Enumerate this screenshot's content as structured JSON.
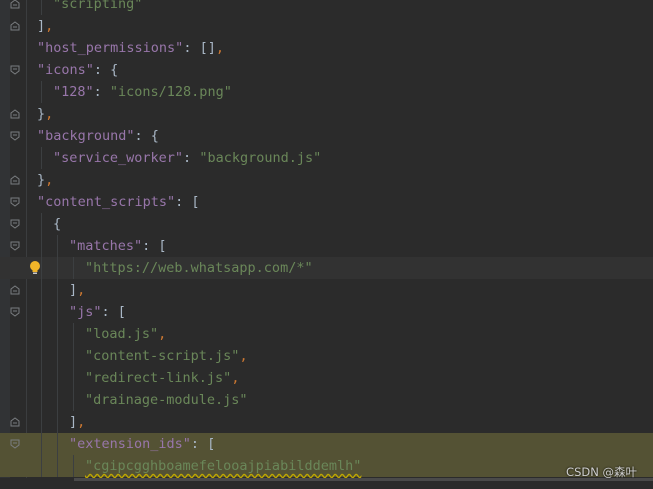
{
  "editor": {
    "lines": [
      {
        "indent": 1,
        "fold": "end",
        "tokens": [
          {
            "t": "\"scripting\"",
            "c": "s"
          }
        ]
      },
      {
        "indent": 0,
        "fold": "end",
        "tokens": [
          {
            "t": "]",
            "c": "p"
          },
          {
            "t": ",",
            "c": "c"
          }
        ]
      },
      {
        "indent": 0,
        "fold": "none",
        "tokens": [
          {
            "t": "\"host_permissions\"",
            "c": "k"
          },
          {
            "t": ": [",
            "c": "p"
          },
          {
            "t": "]",
            "c": "p"
          },
          {
            "t": ",",
            "c": "c"
          }
        ]
      },
      {
        "indent": 0,
        "fold": "start",
        "tokens": [
          {
            "t": "\"icons\"",
            "c": "k"
          },
          {
            "t": ": {",
            "c": "p"
          }
        ]
      },
      {
        "indent": 1,
        "fold": "none",
        "tokens": [
          {
            "t": "\"128\"",
            "c": "k"
          },
          {
            "t": ": ",
            "c": "p"
          },
          {
            "t": "\"icons/128.png\"",
            "c": "s"
          }
        ]
      },
      {
        "indent": 0,
        "fold": "end",
        "tokens": [
          {
            "t": "}",
            "c": "p"
          },
          {
            "t": ",",
            "c": "c"
          }
        ]
      },
      {
        "indent": 0,
        "fold": "start",
        "tokens": [
          {
            "t": "\"background\"",
            "c": "k"
          },
          {
            "t": ": {",
            "c": "p"
          }
        ]
      },
      {
        "indent": 1,
        "fold": "none",
        "tokens": [
          {
            "t": "\"service_worker\"",
            "c": "k"
          },
          {
            "t": ": ",
            "c": "p"
          },
          {
            "t": "\"background.js\"",
            "c": "s"
          }
        ]
      },
      {
        "indent": 0,
        "fold": "end",
        "tokens": [
          {
            "t": "}",
            "c": "p"
          },
          {
            "t": ",",
            "c": "c"
          }
        ]
      },
      {
        "indent": 0,
        "fold": "start",
        "tokens": [
          {
            "t": "\"content_scripts\"",
            "c": "k"
          },
          {
            "t": ": [",
            "c": "p"
          }
        ]
      },
      {
        "indent": 1,
        "fold": "start",
        "tokens": [
          {
            "t": "{",
            "c": "p"
          }
        ]
      },
      {
        "indent": 2,
        "fold": "start",
        "tokens": [
          {
            "t": "\"matches\"",
            "c": "k"
          },
          {
            "t": ": [",
            "c": "p"
          }
        ]
      },
      {
        "indent": 3,
        "fold": "none",
        "caret": true,
        "bulb": true,
        "tokens": [
          {
            "t": "\"https://web.whatsapp.com/*\"",
            "c": "s"
          }
        ]
      },
      {
        "indent": 2,
        "fold": "end",
        "tokens": [
          {
            "t": "]",
            "c": "p"
          },
          {
            "t": ",",
            "c": "c"
          }
        ]
      },
      {
        "indent": 2,
        "fold": "start",
        "tokens": [
          {
            "t": "\"js\"",
            "c": "k"
          },
          {
            "t": ": [",
            "c": "p"
          }
        ]
      },
      {
        "indent": 3,
        "fold": "none",
        "tokens": [
          {
            "t": "\"load.js\"",
            "c": "s"
          },
          {
            "t": ",",
            "c": "c"
          }
        ]
      },
      {
        "indent": 3,
        "fold": "none",
        "tokens": [
          {
            "t": "\"content-script.js\"",
            "c": "s"
          },
          {
            "t": ",",
            "c": "c"
          }
        ]
      },
      {
        "indent": 3,
        "fold": "none",
        "tokens": [
          {
            "t": "\"redirect-link.js\"",
            "c": "s"
          },
          {
            "t": ",",
            "c": "c"
          }
        ]
      },
      {
        "indent": 3,
        "fold": "none",
        "tokens": [
          {
            "t": "\"drainage-module.js\"",
            "c": "s"
          }
        ]
      },
      {
        "indent": 2,
        "fold": "end",
        "tokens": [
          {
            "t": "]",
            "c": "p"
          },
          {
            "t": ",",
            "c": "c"
          }
        ]
      },
      {
        "indent": 2,
        "fold": "start",
        "highlight": true,
        "tokens": [
          {
            "t": "\"extension_ids\"",
            "c": "k"
          },
          {
            "t": ": [",
            "c": "p"
          }
        ]
      },
      {
        "indent": 3,
        "fold": "none",
        "highlight": true,
        "squiggle": true,
        "tokens": [
          {
            "t": "\"cgipcgghboamefelooajpiabilddemlh\"",
            "c": "s"
          }
        ]
      }
    ]
  },
  "watermark": "CSDN @森叶",
  "colors": {
    "background": "#2b2b2b",
    "key": "#9876aa",
    "string": "#6a8759",
    "punctuation": "#a9b7c6",
    "comma": "#cc7832",
    "highlight": "#545234"
  }
}
